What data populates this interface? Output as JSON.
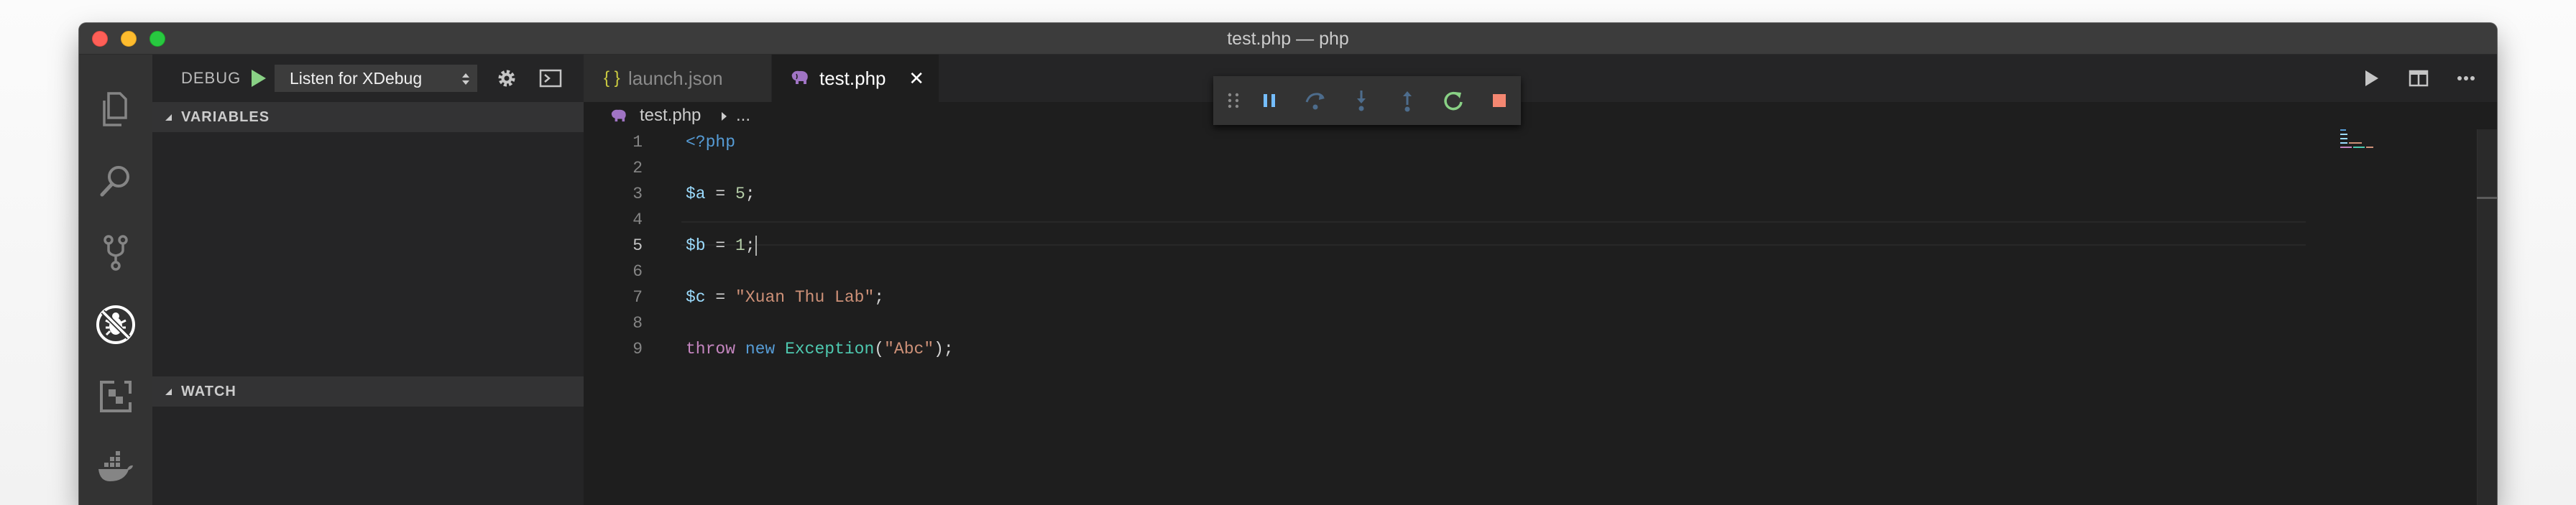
{
  "window": {
    "title": "test.php — php"
  },
  "activity_bar": {
    "items": [
      {
        "name": "explorer",
        "icon": "files-icon",
        "active": false
      },
      {
        "name": "search",
        "icon": "search-icon",
        "active": false
      },
      {
        "name": "source-control",
        "icon": "git-branch-icon",
        "active": false
      },
      {
        "name": "debug",
        "icon": "no-bug-icon",
        "active": true
      },
      {
        "name": "extensions",
        "icon": "extensions-icon",
        "active": false
      },
      {
        "name": "docker",
        "icon": "docker-icon",
        "active": false
      }
    ]
  },
  "sidebar": {
    "debug_label": "DEBUG",
    "configuration": "Listen for XDebug",
    "sections": {
      "variables": "VARIABLES",
      "watch": "WATCH"
    }
  },
  "tabs": [
    {
      "icon": "{ }",
      "label": "launch.json",
      "active": false
    },
    {
      "icon": "php-elephant-icon",
      "label": "test.php",
      "active": true,
      "close": "✕"
    }
  ],
  "breadcrumbs": {
    "file": "test.php",
    "more": "..."
  },
  "editor": {
    "active_line": 5,
    "line_numbers": [
      "1",
      "2",
      "3",
      "4",
      "5",
      "6",
      "7",
      "8",
      "9"
    ]
  },
  "colors": {
    "accent_blue": "#569cd6",
    "variable": "#9cdcfe",
    "string": "#ce9178",
    "number": "#b5cea8",
    "keyword": "#c586c0",
    "class": "#4ec9b0",
    "debug_pause": "#75beff",
    "debug_restart": "#89d185",
    "debug_stop": "#f48771"
  },
  "debug_controls": [
    "drag-handle",
    "pause",
    "step-over",
    "step-into",
    "step-out",
    "restart",
    "stop"
  ]
}
